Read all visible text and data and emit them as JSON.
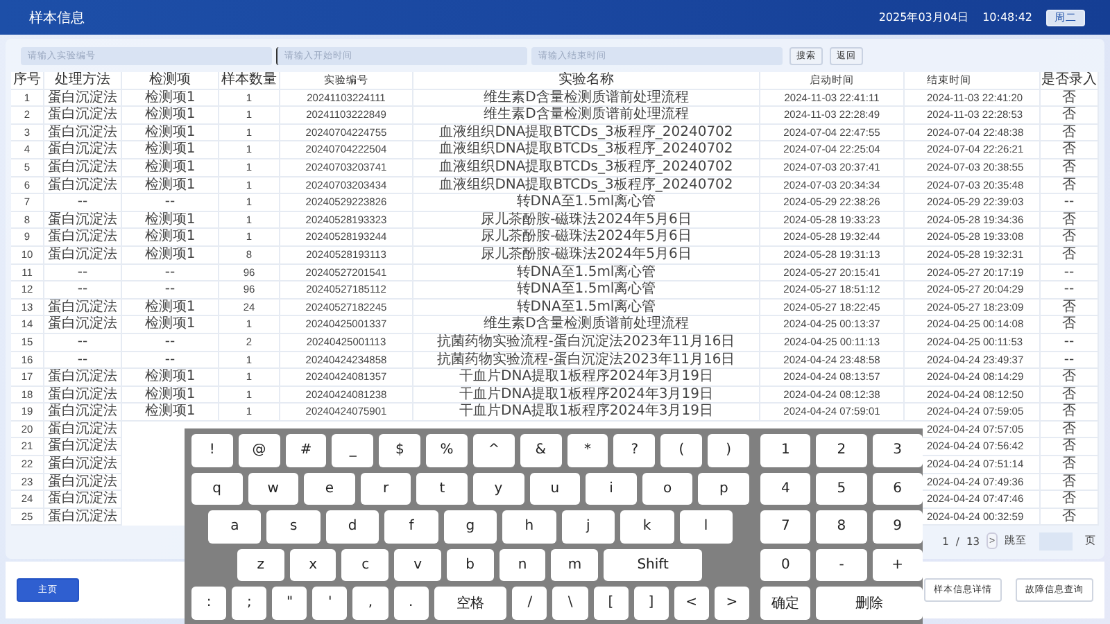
{
  "header": {
    "title": "样本信息",
    "date": "2025年03月04日",
    "time": "10:48:42",
    "weekday": "周二"
  },
  "filters": [
    {
      "placeholder": "请输入实验编号",
      "focused": false
    },
    {
      "placeholder": "请输入开始时间",
      "focused": true
    },
    {
      "placeholder": "请输入结束时间",
      "focused": false
    }
  ],
  "filter_buttons": [
    "搜索",
    "返回"
  ],
  "table": {
    "columns": [
      "序号",
      "处理方法",
      "检测项",
      "样本数量",
      "实验编号",
      "实验名称",
      "启动时间",
      "结束时间",
      "是否录入"
    ],
    "rows": [
      [
        "1",
        "蛋白沉淀法",
        "检测项1",
        "1",
        "20241103224111",
        "维生素D含量检测质谱前处理流程",
        "2024-11-03 22:41:11",
        "2024-11-03 22:41:20",
        "否"
      ],
      [
        "2",
        "蛋白沉淀法",
        "检测项1",
        "1",
        "20241103222849",
        "维生素D含量检测质谱前处理流程",
        "2024-11-03 22:28:49",
        "2024-11-03 22:28:53",
        "否"
      ],
      [
        "3",
        "蛋白沉淀法",
        "检测项1",
        "1",
        "20240704224755",
        "血液组织DNA提取BTCDs_3板程序_20240702",
        "2024-07-04 22:47:55",
        "2024-07-04 22:48:38",
        "否"
      ],
      [
        "4",
        "蛋白沉淀法",
        "检测项1",
        "1",
        "20240704222504",
        "血液组织DNA提取BTCDs_3板程序_20240702",
        "2024-07-04 22:25:04",
        "2024-07-04 22:26:21",
        "否"
      ],
      [
        "5",
        "蛋白沉淀法",
        "检测项1",
        "1",
        "20240703203741",
        "血液组织DNA提取BTCDs_3板程序_20240702",
        "2024-07-03 20:37:41",
        "2024-07-03 20:38:55",
        "否"
      ],
      [
        "6",
        "蛋白沉淀法",
        "检测项1",
        "1",
        "20240703203434",
        "血液组织DNA提取BTCDs_3板程序_20240702",
        "2024-07-03 20:34:34",
        "2024-07-03 20:35:48",
        "否"
      ],
      [
        "7",
        "--",
        "--",
        "1",
        "20240529223826",
        "转DNA至1.5ml离心管",
        "2024-05-29 22:38:26",
        "2024-05-29 22:39:03",
        "--"
      ],
      [
        "8",
        "蛋白沉淀法",
        "检测项1",
        "1",
        "20240528193323",
        "尿儿茶酚胺-磁珠法2024年5月6日",
        "2024-05-28 19:33:23",
        "2024-05-28 19:34:36",
        "否"
      ],
      [
        "9",
        "蛋白沉淀法",
        "检测项1",
        "1",
        "20240528193244",
        "尿儿茶酚胺-磁珠法2024年5月6日",
        "2024-05-28 19:32:44",
        "2024-05-28 19:33:08",
        "否"
      ],
      [
        "10",
        "蛋白沉淀法",
        "检测项1",
        "8",
        "20240528193113",
        "尿儿茶酚胺-磁珠法2024年5月6日",
        "2024-05-28 19:31:13",
        "2024-05-28 19:32:31",
        "否"
      ],
      [
        "11",
        "--",
        "--",
        "96",
        "20240527201541",
        "转DNA至1.5ml离心管",
        "2024-05-27 20:15:41",
        "2024-05-27 20:17:19",
        "--"
      ],
      [
        "12",
        "--",
        "--",
        "96",
        "20240527185112",
        "转DNA至1.5ml离心管",
        "2024-05-27 18:51:12",
        "2024-05-27 20:04:29",
        "--"
      ],
      [
        "13",
        "蛋白沉淀法",
        "检测项1",
        "24",
        "20240527182245",
        "转DNA至1.5ml离心管",
        "2024-05-27 18:22:45",
        "2024-05-27 18:23:09",
        "否"
      ],
      [
        "14",
        "蛋白沉淀法",
        "检测项1",
        "1",
        "20240425001337",
        "维生素D含量检测质谱前处理流程",
        "2024-04-25 00:13:37",
        "2024-04-25 00:14:08",
        "否"
      ],
      [
        "15",
        "--",
        "--",
        "2",
        "20240425001113",
        "抗菌药物实验流程-蛋白沉淀法2023年11月16日",
        "2024-04-25 00:11:13",
        "2024-04-25 00:11:53",
        "--"
      ],
      [
        "16",
        "--",
        "--",
        "1",
        "20240424234858",
        "抗菌药物实验流程-蛋白沉淀法2023年11月16日",
        "2024-04-24 23:48:58",
        "2024-04-24 23:49:37",
        "--"
      ],
      [
        "17",
        "蛋白沉淀法",
        "检测项1",
        "1",
        "20240424081357",
        "干血片DNA提取1板程序2024年3月19日",
        "2024-04-24 08:13:57",
        "2024-04-24 08:14:29",
        "否"
      ],
      [
        "18",
        "蛋白沉淀法",
        "检测项1",
        "1",
        "20240424081238",
        "干血片DNA提取1板程序2024年3月19日",
        "2024-04-24 08:12:38",
        "2024-04-24 08:12:50",
        "否"
      ],
      [
        "19",
        "蛋白沉淀法",
        "检测项1",
        "1",
        "20240424075901",
        "干血片DNA提取1板程序2024年3月19日",
        "2024-04-24 07:59:01",
        "2024-04-24 07:59:05",
        "否"
      ],
      [
        "20",
        "蛋白沉淀法",
        null,
        null,
        null,
        null,
        null,
        "2024-04-24 07:57:05",
        "否"
      ],
      [
        "21",
        "蛋白沉淀法",
        null,
        null,
        null,
        null,
        null,
        "2024-04-24 07:56:42",
        "否"
      ],
      [
        "22",
        "蛋白沉淀法",
        null,
        null,
        null,
        null,
        null,
        "2024-04-24 07:51:14",
        "否"
      ],
      [
        "23",
        "蛋白沉淀法",
        null,
        null,
        null,
        null,
        null,
        "2024-04-24 07:49:36",
        "否"
      ],
      [
        "24",
        "蛋白沉淀法",
        null,
        null,
        null,
        null,
        null,
        "2024-04-24 07:47:46",
        "否"
      ],
      [
        "25",
        "蛋白沉淀法",
        null,
        null,
        null,
        null,
        null,
        "2024-04-24 00:32:59",
        "否"
      ]
    ]
  },
  "pagination": {
    "current": "1",
    "separator": "/",
    "total": "13",
    "next": ">",
    "jump_label": "跳至",
    "page_unit": "页"
  },
  "bottom_buttons": [
    {
      "label": "主页",
      "kind": "primary"
    },
    {
      "label": "样本信息详情",
      "kind": "outline"
    },
    {
      "label": "故障信息查询",
      "kind": "outline"
    }
  ],
  "keyboard": {
    "symbol_keys": [
      "!",
      "@",
      "#",
      "_",
      "$",
      "%",
      "^",
      "&",
      "*",
      "?",
      "(",
      ")"
    ],
    "top_letter_keys": [
      "q",
      "w",
      "e",
      "r",
      "t",
      "y",
      "u",
      "i",
      "o",
      "p"
    ],
    "middle_letter_keys": [
      "a",
      "s",
      "d",
      "f",
      "g",
      "h",
      "j",
      "k",
      "l"
    ],
    "bottom_letter_keys": [
      {
        "label": "z",
        "kind": "key"
      },
      {
        "label": "x",
        "kind": "key"
      },
      {
        "label": "c",
        "kind": "key"
      },
      {
        "label": "v",
        "kind": "key"
      },
      {
        "label": "b",
        "kind": "key"
      },
      {
        "label": "n",
        "kind": "key"
      },
      {
        "label": "m",
        "kind": "key"
      },
      {
        "label": "Shift",
        "kind": "wide"
      }
    ],
    "punctuation_keys": [
      {
        "label": ":",
        "kind": "key"
      },
      {
        "label": ";",
        "kind": "key"
      },
      {
        "label": "\"",
        "kind": "key"
      },
      {
        "label": "'",
        "kind": "key"
      },
      {
        "label": ",",
        "kind": "key"
      },
      {
        "label": ".",
        "kind": "key"
      },
      {
        "label": "空格",
        "kind": "wide"
      },
      {
        "label": "/",
        "kind": "key"
      },
      {
        "label": "\\",
        "kind": "key"
      },
      {
        "label": "[",
        "kind": "key"
      },
      {
        "label": "]",
        "kind": "key"
      },
      {
        "label": "<",
        "kind": "key"
      },
      {
        "label": ">",
        "kind": "key"
      }
    ],
    "numpad_keys": [
      {
        "label": "1",
        "kind": "key"
      },
      {
        "label": "2",
        "kind": "key"
      },
      {
        "label": "3",
        "kind": "key"
      },
      {
        "label": "4",
        "kind": "key"
      },
      {
        "label": "5",
        "kind": "key"
      },
      {
        "label": "6",
        "kind": "key"
      },
      {
        "label": "7",
        "kind": "key"
      },
      {
        "label": "8",
        "kind": "key"
      },
      {
        "label": "9",
        "kind": "key"
      },
      {
        "label": "0",
        "kind": "key"
      },
      {
        "label": "-",
        "kind": "key"
      },
      {
        "label": "+",
        "kind": "key"
      },
      {
        "label": "确定",
        "kind": "key"
      },
      {
        "label": "删除",
        "kind": "wide"
      }
    ]
  }
}
